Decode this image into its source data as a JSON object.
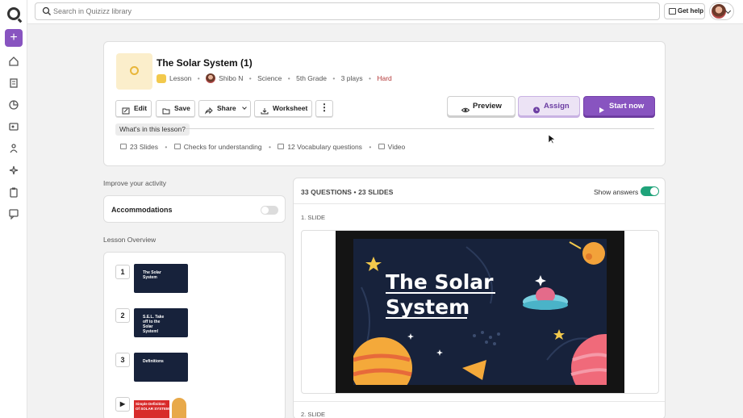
{
  "search": {
    "placeholder": "Search in Quizizz library"
  },
  "header": {
    "help_label": "Get help"
  },
  "lesson": {
    "title": "The Solar System (1)",
    "type": "Lesson",
    "author": "Shibo N",
    "subject": "Science",
    "grade": "5th Grade",
    "plays": "3 plays",
    "difficulty": "Hard",
    "difficulty_color": "#b43a3a"
  },
  "toolbar": {
    "edit": "Edit",
    "save": "Save",
    "share": "Share",
    "worksheet": "Worksheet",
    "more": "⋮",
    "preview": "Preview",
    "assign": "Assign",
    "start": "Start now"
  },
  "contents": {
    "heading": "What's in this lesson?",
    "items": [
      "23 Slides",
      "Checks for understanding",
      "12 Vocabulary questions",
      "Video"
    ]
  },
  "improve": {
    "heading": "Improve your activity",
    "accommodations": "Accommodations"
  },
  "overview": {
    "heading": "Lesson Overview",
    "items": [
      {
        "num": "1",
        "thumb_text": "The Solar System"
      },
      {
        "num": "2",
        "thumb_text": "S.E.L. Take off to the Solar System!"
      },
      {
        "num": "3",
        "thumb_text": "Definitions"
      },
      {
        "num": "",
        "thumb_text": "Simple Definition Of SOLAR SYSTEM"
      }
    ]
  },
  "questions": {
    "summary": "33 QUESTIONS • 23 SLIDES",
    "show_answers": "Show answers",
    "slides": [
      {
        "label": "1. SLIDE",
        "title_line1": "The Solar",
        "title_line2": "System"
      },
      {
        "label": "2. SLIDE"
      }
    ]
  },
  "colors": {
    "accent": "#8854c0",
    "toggle_on": "#1fa37a",
    "slide_bg": "#17223b"
  }
}
